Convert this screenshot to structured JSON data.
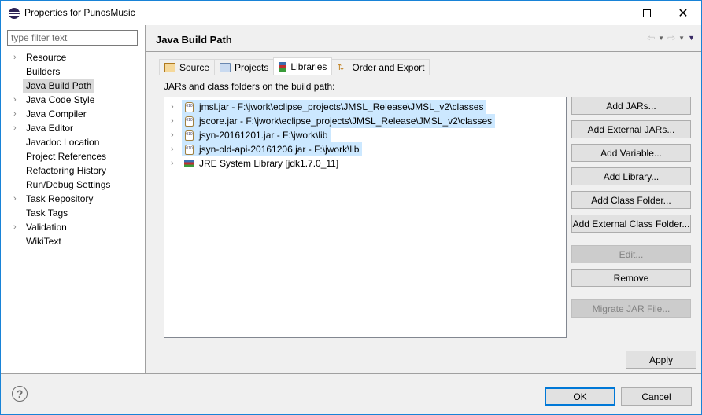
{
  "window": {
    "title": "Properties for PunosMusic",
    "app_icon": "eclipse-icon",
    "controls": {
      "minimize": "minimize-icon",
      "maximize": "maximize-icon",
      "close": "✕"
    }
  },
  "sidebar": {
    "filter_placeholder": "type filter text",
    "items": [
      {
        "label": "Resource",
        "expandable": true,
        "selected": false
      },
      {
        "label": "Builders",
        "expandable": false,
        "selected": false
      },
      {
        "label": "Java Build Path",
        "expandable": false,
        "selected": true
      },
      {
        "label": "Java Code Style",
        "expandable": true,
        "selected": false
      },
      {
        "label": "Java Compiler",
        "expandable": true,
        "selected": false
      },
      {
        "label": "Java Editor",
        "expandable": true,
        "selected": false
      },
      {
        "label": "Javadoc Location",
        "expandable": false,
        "selected": false
      },
      {
        "label": "Project References",
        "expandable": false,
        "selected": false
      },
      {
        "label": "Refactoring History",
        "expandable": false,
        "selected": false
      },
      {
        "label": "Run/Debug Settings",
        "expandable": false,
        "selected": false
      },
      {
        "label": "Task Repository",
        "expandable": true,
        "selected": false
      },
      {
        "label": "Task Tags",
        "expandable": false,
        "selected": false
      },
      {
        "label": "Validation",
        "expandable": true,
        "selected": false
      },
      {
        "label": "WikiText",
        "expandable": false,
        "selected": false
      }
    ]
  },
  "page": {
    "title": "Java Build Path",
    "nav": {
      "back": "⇦",
      "forward": "⇨",
      "dropdown": "▼",
      "menu": "▼"
    },
    "tabs": [
      {
        "label": "Source",
        "icon": "source-folder-icon",
        "active": false
      },
      {
        "label": "Projects",
        "icon": "projects-folder-icon",
        "active": false
      },
      {
        "label": "Libraries",
        "icon": "libraries-icon",
        "active": true
      },
      {
        "label": "Order and Export",
        "icon": "order-export-icon",
        "active": false
      }
    ],
    "section_label": "JARs and class folders on the build path:",
    "libraries": [
      {
        "label": "jmsl.jar - F:\\jwork\\eclipse_projects\\JMSL_Release\\JMSL_v2\\classes",
        "type": "jar",
        "selected": true
      },
      {
        "label": "jscore.jar - F:\\jwork\\eclipse_projects\\JMSL_Release\\JMSL_v2\\classes",
        "type": "jar",
        "selected": true
      },
      {
        "label": "jsyn-20161201.jar - F:\\jwork\\lib",
        "type": "jar",
        "selected": true
      },
      {
        "label": "jsyn-old-api-20161206.jar - F:\\jwork\\lib",
        "type": "jar",
        "selected": true
      },
      {
        "label": "JRE System Library [jdk1.7.0_11]",
        "type": "jre",
        "selected": false
      }
    ],
    "buttons": {
      "add_jars": "Add JARs...",
      "add_external_jars": "Add External JARs...",
      "add_variable": "Add Variable...",
      "add_library": "Add Library...",
      "add_class_folder": "Add Class Folder...",
      "add_external_class_folder": "Add External Class Folder...",
      "edit": "Edit...",
      "remove": "Remove",
      "migrate_jar": "Migrate JAR File..."
    },
    "apply_label": "Apply"
  },
  "footer": {
    "help": "?",
    "ok_label": "OK",
    "cancel_label": "Cancel"
  }
}
